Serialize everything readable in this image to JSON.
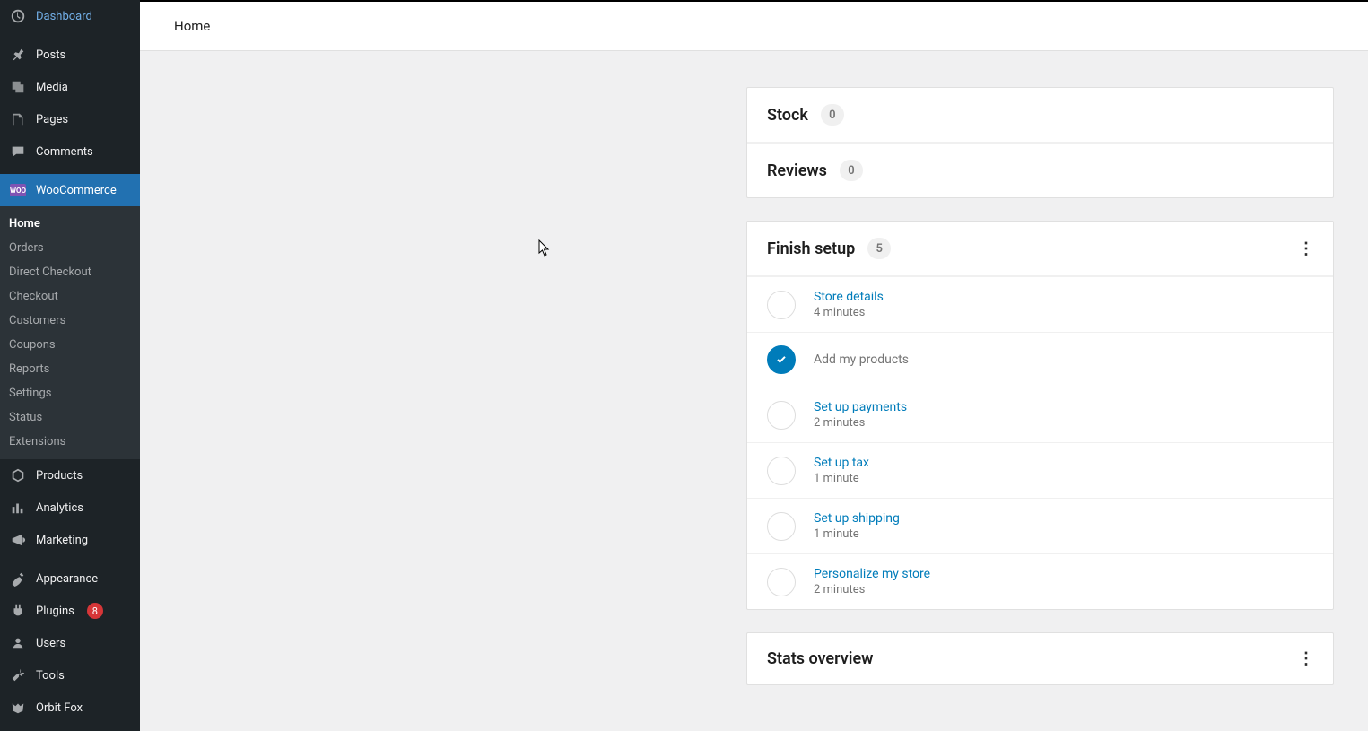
{
  "header": {
    "title": "Home"
  },
  "sidebar": {
    "items": [
      {
        "label": "Dashboard"
      },
      {
        "label": "Posts"
      },
      {
        "label": "Media"
      },
      {
        "label": "Pages"
      },
      {
        "label": "Comments"
      },
      {
        "label": "WooCommerce"
      },
      {
        "label": "Products"
      },
      {
        "label": "Analytics"
      },
      {
        "label": "Marketing"
      },
      {
        "label": "Appearance"
      },
      {
        "label": "Plugins"
      },
      {
        "label": "Users"
      },
      {
        "label": "Tools"
      },
      {
        "label": "Orbit Fox"
      }
    ],
    "plugins_badge": "8"
  },
  "submenu": {
    "items": [
      "Home",
      "Orders",
      "Direct Checkout",
      "Checkout",
      "Customers",
      "Coupons",
      "Reports",
      "Settings",
      "Status",
      "Extensions"
    ]
  },
  "stock": {
    "title": "Stock",
    "count": "0"
  },
  "reviews": {
    "title": "Reviews",
    "count": "0"
  },
  "finish": {
    "title": "Finish setup",
    "count": "5",
    "tasks": [
      {
        "title": "Store details",
        "time": "4 minutes",
        "done": false
      },
      {
        "title": "Add my products",
        "time": "",
        "done": true
      },
      {
        "title": "Set up payments",
        "time": "2 minutes",
        "done": false
      },
      {
        "title": "Set up tax",
        "time": "1 minute",
        "done": false
      },
      {
        "title": "Set up shipping",
        "time": "1 minute",
        "done": false
      },
      {
        "title": "Personalize my store",
        "time": "2 minutes",
        "done": false
      }
    ]
  },
  "stats": {
    "title": "Stats overview"
  },
  "icons": {
    "woo_text": "WOO",
    "check": "✓",
    "kebab": "⋮"
  }
}
